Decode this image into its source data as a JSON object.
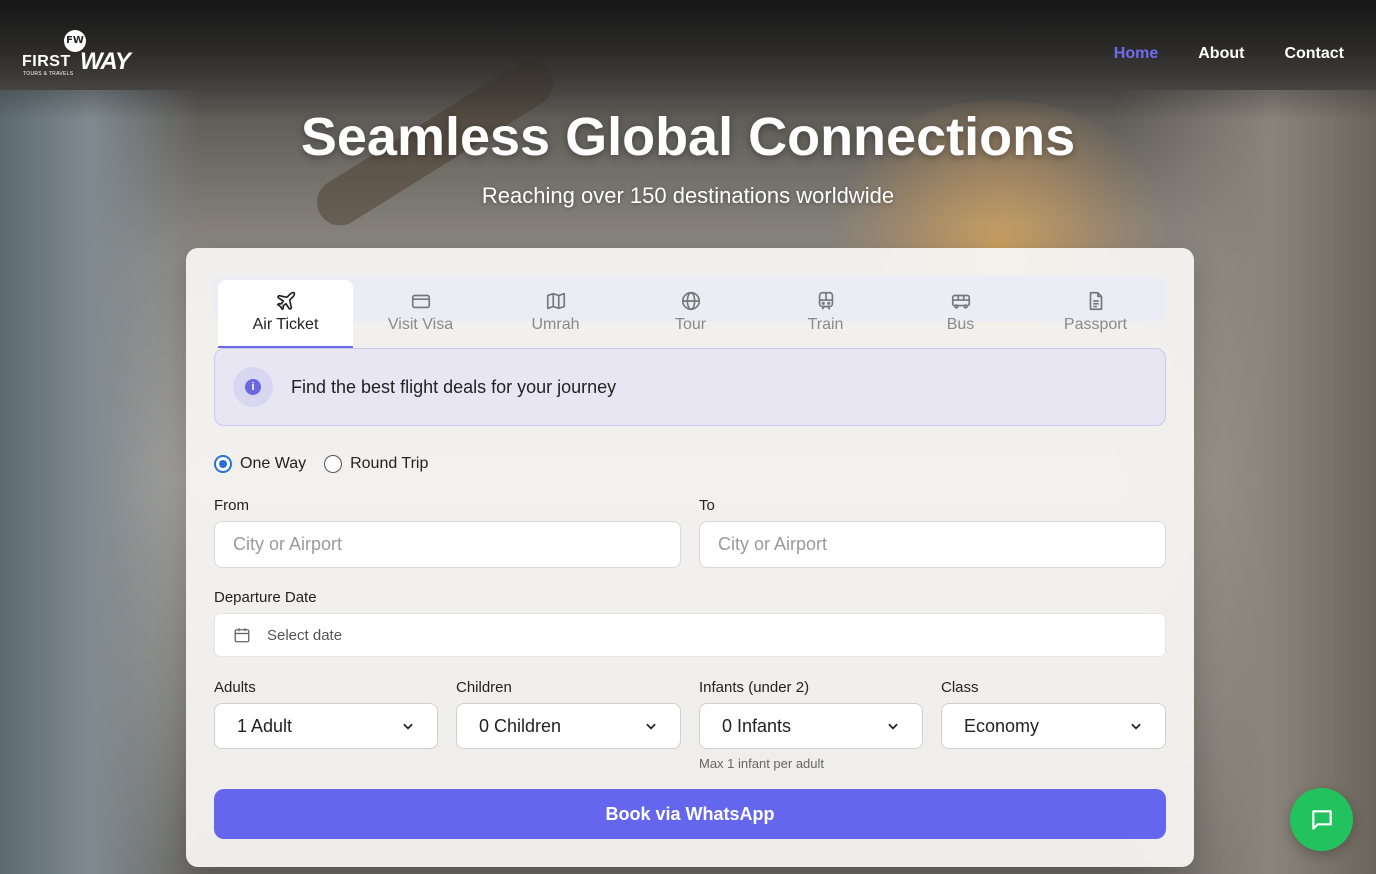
{
  "logo": {
    "monogram": "FW",
    "word1": "FIRST",
    "word2": "WAY",
    "tagline": "TOURS & TRAVELS"
  },
  "nav": {
    "home": "Home",
    "about": "About",
    "contact": "Contact"
  },
  "hero": {
    "title": "Seamless Global Connections",
    "subtitle": "Reaching over 150 destinations worldwide"
  },
  "tabs": [
    {
      "label": "Air Ticket",
      "icon": "plane-icon"
    },
    {
      "label": "Visit Visa",
      "icon": "card-icon"
    },
    {
      "label": "Umrah",
      "icon": "map-icon"
    },
    {
      "label": "Tour",
      "icon": "globe-icon"
    },
    {
      "label": "Train",
      "icon": "train-icon"
    },
    {
      "label": "Bus",
      "icon": "bus-icon"
    },
    {
      "label": "Passport",
      "icon": "document-icon"
    }
  ],
  "info": {
    "text": "Find the best flight deals for your journey",
    "icon": "info-icon"
  },
  "trip": {
    "one_way": "One Way",
    "round_trip": "Round Trip"
  },
  "form": {
    "from_label": "From",
    "from_placeholder": "City or Airport",
    "to_label": "To",
    "to_placeholder": "City or Airport",
    "departure_label": "Departure Date",
    "departure_placeholder": "Select date",
    "adults_label": "Adults",
    "adults_value": "1 Adult",
    "children_label": "Children",
    "children_value": "0 Children",
    "infants_label": "Infants (under 2)",
    "infants_value": "0 Infants",
    "infants_hint": "Max 1 infant per adult",
    "class_label": "Class",
    "class_value": "Economy"
  },
  "book_button": "Book via WhatsApp",
  "colors": {
    "accent": "#6467ee",
    "nav_active": "#6e6df0",
    "chat": "#22c35e",
    "radio": "#2b6fd6"
  }
}
